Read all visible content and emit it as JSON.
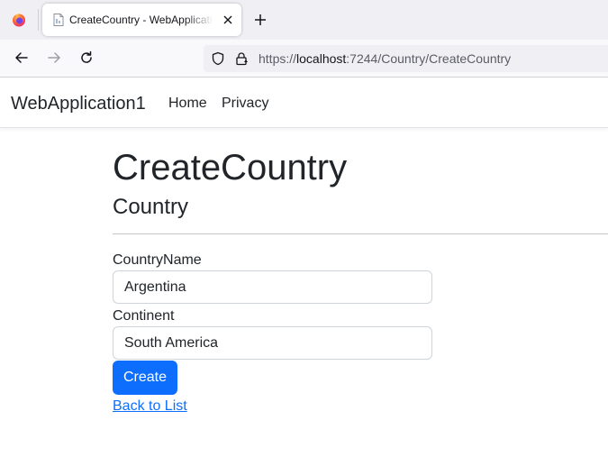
{
  "browser": {
    "tab": {
      "title": "CreateCountry - WebApplication1"
    },
    "address_bar": {
      "scheme": "https://",
      "host": "localhost",
      "path": ":7244/Country/CreateCountry"
    },
    "icons": [
      "firefox-icon",
      "page-icon",
      "close-icon",
      "plus-icon",
      "back-arrow-icon",
      "forward-arrow-icon",
      "reload-icon",
      "shield-icon",
      "lock-icon"
    ]
  },
  "navbar": {
    "brand": "WebApplication1",
    "links": [
      "Home",
      "Privacy"
    ]
  },
  "page": {
    "title": "CreateCountry",
    "subtitle": "Country",
    "form": {
      "country_name": {
        "label": "CountryName",
        "value": "Argentina"
      },
      "continent": {
        "label": "Continent",
        "value": "South America"
      },
      "submit_label": "Create"
    },
    "back_link": "Back to List"
  },
  "colors": {
    "primary": "#0d6efd",
    "text": "#212529",
    "tabstrip": "#f0f0f4",
    "toolbar": "#f9f9fb"
  }
}
